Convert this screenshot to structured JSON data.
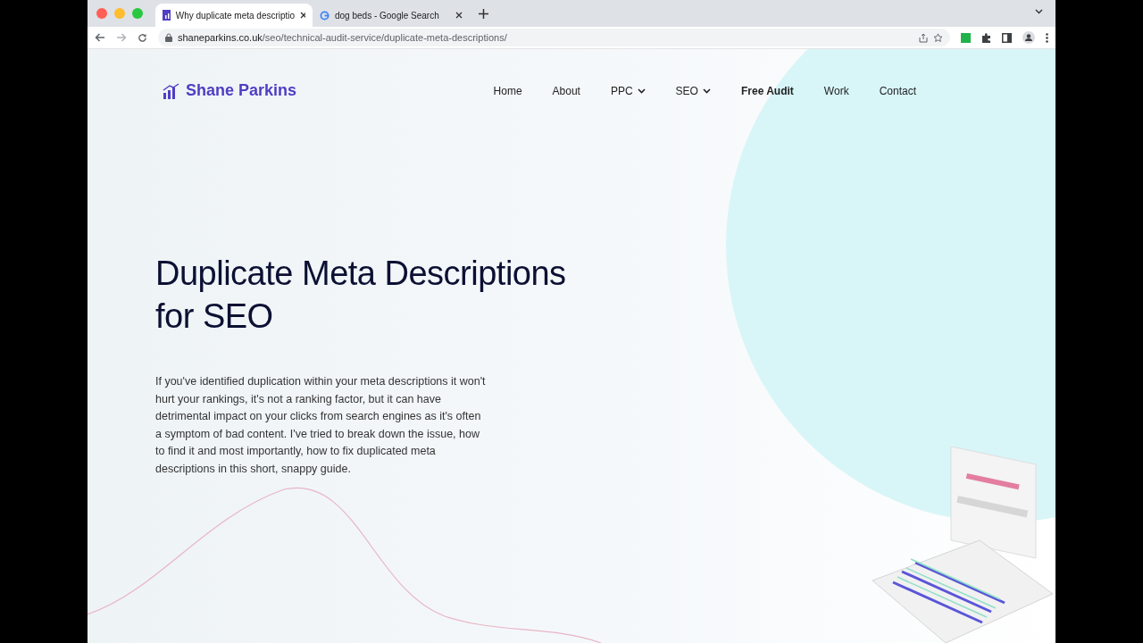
{
  "browser": {
    "tabs": [
      {
        "title": "Why duplicate meta descriptio",
        "selected": true
      },
      {
        "title": "dog beds - Google Search",
        "selected": false
      }
    ],
    "address": {
      "domain": "shaneparkins.co.uk",
      "path": "/seo/technical-audit-service/duplicate-meta-descriptions/"
    }
  },
  "site": {
    "logo": "Shane Parkins",
    "nav": [
      {
        "label": "Home",
        "dropdown": false,
        "highlighted": false
      },
      {
        "label": "About",
        "dropdown": false,
        "highlighted": false
      },
      {
        "label": "PPC",
        "dropdown": true,
        "highlighted": false
      },
      {
        "label": "SEO",
        "dropdown": true,
        "highlighted": false
      },
      {
        "label": "Free Audit",
        "dropdown": false,
        "highlighted": true
      },
      {
        "label": "Work",
        "dropdown": false,
        "highlighted": false
      },
      {
        "label": "Contact",
        "dropdown": false,
        "highlighted": false
      }
    ]
  },
  "hero": {
    "title_lines": [
      "Duplicate Meta Descriptions",
      "for SEO"
    ],
    "intro": "If you've identified duplication within your meta descriptions it won't hurt your rankings, it's not a ranking factor, but it can have detrimental impact on your clicks from search engines as it's often a symptom of bad content. I've tried to break down the issue, how to find it and most importantly, how to fix duplicated meta descriptions in this short, snappy guide."
  }
}
